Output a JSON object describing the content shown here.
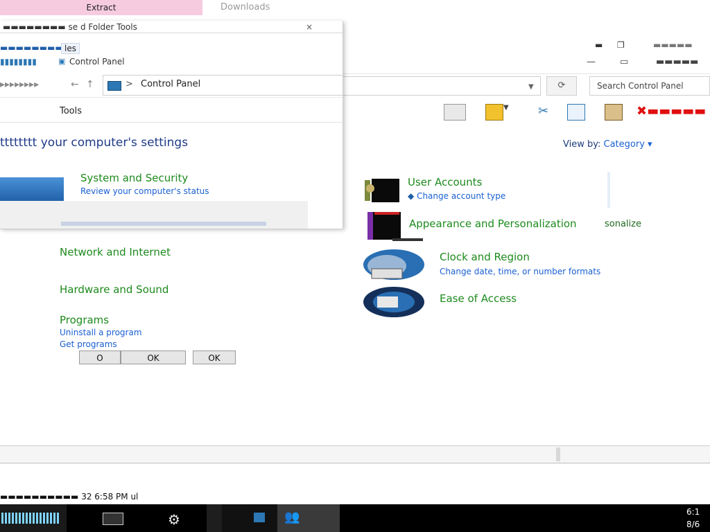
{
  "tabs": {
    "tab1_label": "Extract",
    "tab2_label": "Downloads"
  },
  "front_window": {
    "title": "▬▬▬▬▬▬▬▬ se d Folder Tools",
    "ribbon_tab": "les",
    "window2_title": "Control Panel",
    "address_path": "Control Panel",
    "address_sep": ">",
    "tools_label": "Tools",
    "heading": "tttttttt your computer's settings",
    "system_security": {
      "title": "System and Security",
      "sub": "Review your computer's status"
    }
  },
  "main": {
    "search_placeholder": "Search Control Panel",
    "view_by_label": "View by:",
    "view_by_value": "Category",
    "categories_right": [
      {
        "title": "User Accounts",
        "sub": "Change account type"
      },
      {
        "title": "Appearance and Personalization",
        "sub": ""
      },
      {
        "title": "Clock and Region",
        "sub": "Change date, time, or number formats"
      },
      {
        "title": "Ease of Access",
        "sub": ""
      }
    ],
    "personalization_text": "sonalize",
    "categories_left": [
      {
        "title": "Network and Internet"
      },
      {
        "title": "Hardware and Sound"
      },
      {
        "title": "Programs",
        "subs": [
          "Uninstall a program",
          "Get programs"
        ]
      }
    ]
  },
  "dialog_buttons": {
    "ok1": "O",
    "ok2": "OK",
    "ok3": "OK"
  },
  "status_line": "▬▬▬▬▬▬▬▬▬▬ 32 6:58 PM ul",
  "taskbar": {
    "clock_time": "6:1",
    "clock_date": "8/6"
  },
  "colors": {
    "category_title": "#1d8a1d",
    "link": "#1a5fd1",
    "heading": "#1e3a8a",
    "taskbar": "#000000",
    "pink_tab": "#f6cbe0"
  },
  "icons": [
    "search-icon",
    "refresh-icon",
    "folder-icon",
    "cut-icon",
    "copy-icon",
    "paste-icon",
    "delete-icon",
    "user-accounts-icon",
    "appearance-icon",
    "clock-region-icon",
    "ease-of-access-icon",
    "system-security-icon",
    "start-icon",
    "gear-icon",
    "people-icon"
  ]
}
